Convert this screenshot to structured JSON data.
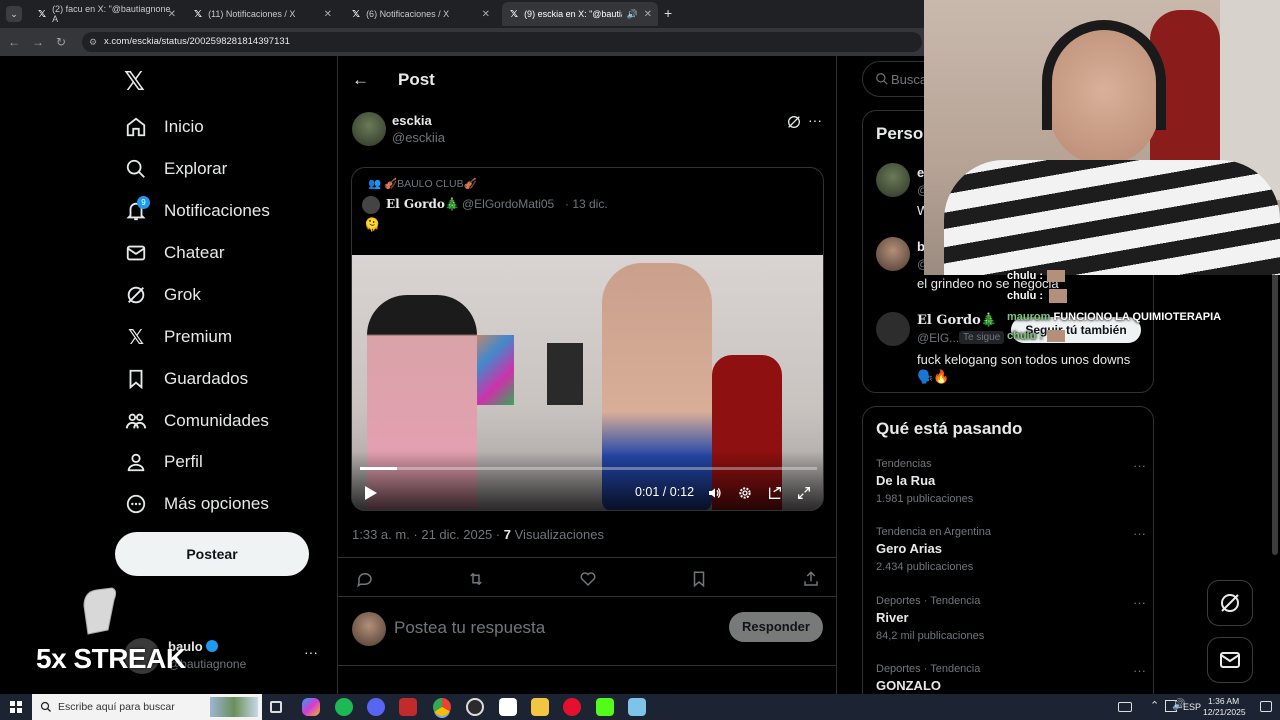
{
  "browser": {
    "tabs": [
      {
        "label": "(2) facu en X: \"@bautiagnone A",
        "active": false
      },
      {
        "label": "(11) Notificaciones / X",
        "active": false
      },
      {
        "label": "(6) Notificaciones / X",
        "active": false
      },
      {
        "label": "(9) esckia en X: \"@bautiagn",
        "active": true
      }
    ],
    "url": "x.com/esckia/status/2002598281814397131"
  },
  "sidebar": {
    "items": [
      {
        "label": "Inicio",
        "icon": "home-icon"
      },
      {
        "label": "Explorar",
        "icon": "search-icon"
      },
      {
        "label": "Notificaciones",
        "icon": "bell-icon",
        "badge": "9"
      },
      {
        "label": "Chatear",
        "icon": "mail-icon"
      },
      {
        "label": "Grok",
        "icon": "grok-icon"
      },
      {
        "label": "Premium",
        "icon": "x-icon"
      },
      {
        "label": "Guardados",
        "icon": "bookmark-icon"
      },
      {
        "label": "Comunidades",
        "icon": "communities-icon"
      },
      {
        "label": "Perfil",
        "icon": "profile-icon"
      },
      {
        "label": "Más opciones",
        "icon": "more-icon"
      }
    ],
    "post_label": "Postear",
    "account": {
      "name": "baulo",
      "handle": "@bautiagnone"
    },
    "streak": "5x STREAK"
  },
  "post": {
    "header_title": "Post",
    "author_name": "esckia",
    "author_handle": "@esckiia",
    "quoted": {
      "community": "🎻BAULO CLUB🎻",
      "author_name": "El Gordo🎄",
      "author_handle": "@ElGordoMati05",
      "date": "· 13 dic.",
      "text": "🫠"
    },
    "video_time": "0:01 / 0:12",
    "video_progress": 0.08,
    "timestamp": "1:33 a. m. · 21 dic. 2025 ·",
    "views_count": "7",
    "views_label": "Visualizaciones",
    "reply_placeholder": "Postea tu respuesta",
    "reply_button": "Responder"
  },
  "right": {
    "search_placeholder": "Buscar",
    "people_title": "Perso",
    "people": [
      {
        "name": "es",
        "handle": "@",
        "text": "W"
      },
      {
        "name": "ba",
        "handle": "@",
        "text": "el grindeo no se negocia"
      },
      {
        "name": "El Gordo🎄",
        "handle": "@ElG...",
        "badge": "Te sigue",
        "text": "fuck kelogang son todos unos downs 🗣️🔥",
        "follow": "Seguir tú también"
      }
    ],
    "trending_title": "Qué está pasando",
    "trends": [
      {
        "meta": "Tendencias",
        "name": "De la Rua",
        "count": "1.981 publicaciones"
      },
      {
        "meta": "Tendencia en Argentina",
        "name": "Gero Arias",
        "count": "2.434 publicaciones"
      },
      {
        "meta": "Deportes · Tendencia",
        "name": "River",
        "count": "84,2 mil publicaciones"
      },
      {
        "meta": "Deportes · Tendencia",
        "name": "GONZALO",
        "count": ""
      }
    ]
  },
  "overlay_chat": [
    {
      "user": "chulu :",
      "msg": ""
    },
    {
      "user": "chulu :",
      "msg": ""
    },
    {
      "user": "maurom",
      "msg": "FUNCIONO LA QUIMIOTERAPIA"
    },
    {
      "user": "chulu :",
      "msg": ""
    }
  ],
  "taskbar": {
    "search_placeholder": "Escribe aquí para buscar",
    "lang": "ESP",
    "time": "1:36 AM",
    "date": "12/21/2025"
  }
}
